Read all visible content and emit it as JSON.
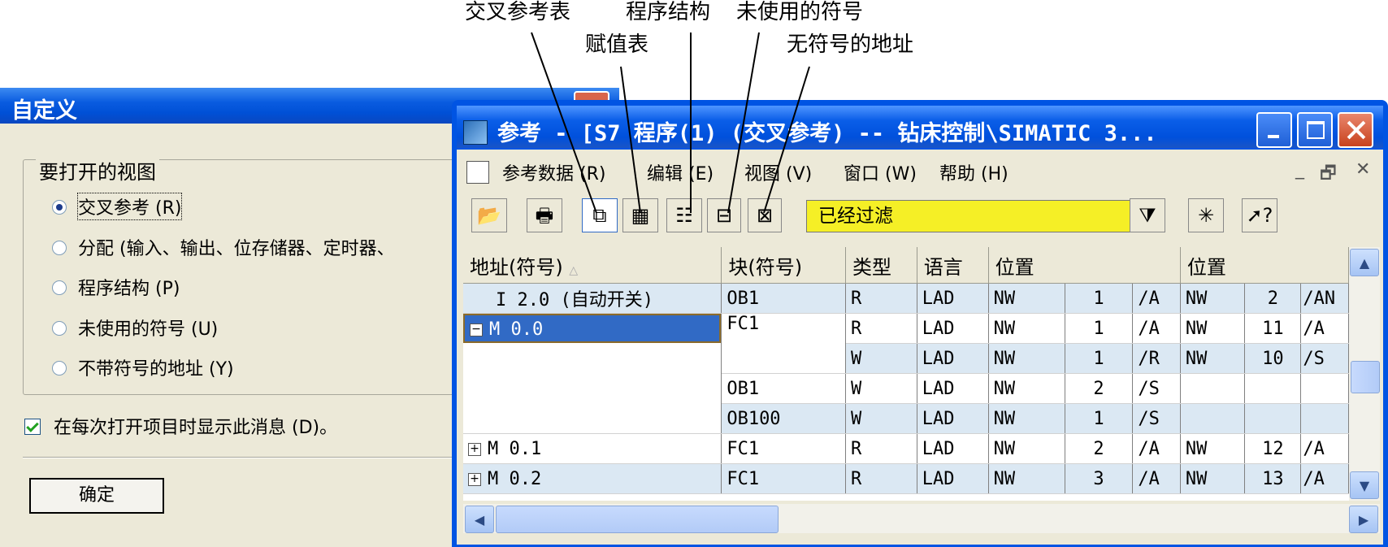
{
  "annotations": {
    "xref_table": "交叉参考表",
    "assignment_table": "赋值表",
    "program_structure": "程序结构",
    "unused_symbols": "未使用的符号",
    "addr_without_symbol": "无符号的地址"
  },
  "dialog": {
    "title": "自定义",
    "group_label": "要打开的视图",
    "options": [
      {
        "label": "交叉参考 (R)",
        "selected": true
      },
      {
        "label": "分配 (输入、输出、位存储器、定时器、",
        "selected": false
      },
      {
        "label": "程序结构 (P)",
        "selected": false
      },
      {
        "label": "未使用的符号 (U)",
        "selected": false
      },
      {
        "label": "不带符号的地址 (Y)",
        "selected": false
      }
    ],
    "checkbox_label": "在每次打开项目时显示此消息 (D)。",
    "checkbox_checked": true,
    "ok_label": "确定"
  },
  "window": {
    "title": "参考 - [S7 程序(1) (交叉参考) -- 钻床控制\\SIMATIC 3...",
    "menu": [
      "参考数据 (R)",
      "编辑 (E)",
      "视图 (V)",
      "窗口 (W)",
      "帮助 (H)"
    ],
    "mdi_controls": [
      "_",
      "🗗",
      "✕"
    ],
    "filter_text": "已经过滤",
    "toolbar_icons": [
      "open-icon",
      "print-icon",
      "xref-icon",
      "assignment-icon",
      "program-structure-icon",
      "unused-symbols-icon",
      "addr-without-symbol-icon",
      "filter-icon",
      "new-window-icon",
      "help-icon"
    ]
  },
  "table": {
    "headers": [
      "地址(符号)",
      "块(符号)",
      "类型",
      "语言",
      "位置",
      "位置"
    ],
    "rows": [
      {
        "addr": "I 2.0 (自动开关)",
        "block": "OB1",
        "type": "R",
        "lang": "LAD",
        "l1a": "NW",
        "l1b": "1",
        "l1c": "/A",
        "l2a": "NW",
        "l2b": "2",
        "l2c": "/AN"
      },
      {
        "addr": "M 0.0",
        "block": "FC1",
        "type": "R",
        "lang": "LAD",
        "l1a": "NW",
        "l1b": "1",
        "l1c": "/A",
        "l2a": "NW",
        "l2b": "11",
        "l2c": "/A"
      },
      {
        "addr": "",
        "block": "",
        "type": "W",
        "lang": "LAD",
        "l1a": "NW",
        "l1b": "1",
        "l1c": "/R",
        "l2a": "NW",
        "l2b": "10",
        "l2c": "/S"
      },
      {
        "addr": "",
        "block": "OB1",
        "type": "W",
        "lang": "LAD",
        "l1a": "NW",
        "l1b": "2",
        "l1c": "/S",
        "l2a": "",
        "l2b": "",
        "l2c": ""
      },
      {
        "addr": "",
        "block": "OB100",
        "type": "W",
        "lang": "LAD",
        "l1a": "NW",
        "l1b": "1",
        "l1c": "/S",
        "l2a": "",
        "l2b": "",
        "l2c": ""
      },
      {
        "addr": "M 0.1",
        "block": "FC1",
        "type": "R",
        "lang": "LAD",
        "l1a": "NW",
        "l1b": "2",
        "l1c": "/A",
        "l2a": "NW",
        "l2b": "12",
        "l2c": "/A"
      },
      {
        "addr": "M 0.2",
        "block": "FC1",
        "type": "R",
        "lang": "LAD",
        "l1a": "NW",
        "l1b": "3",
        "l1c": "/A",
        "l2a": "NW",
        "l2b": "13",
        "l2c": "/A"
      }
    ]
  }
}
